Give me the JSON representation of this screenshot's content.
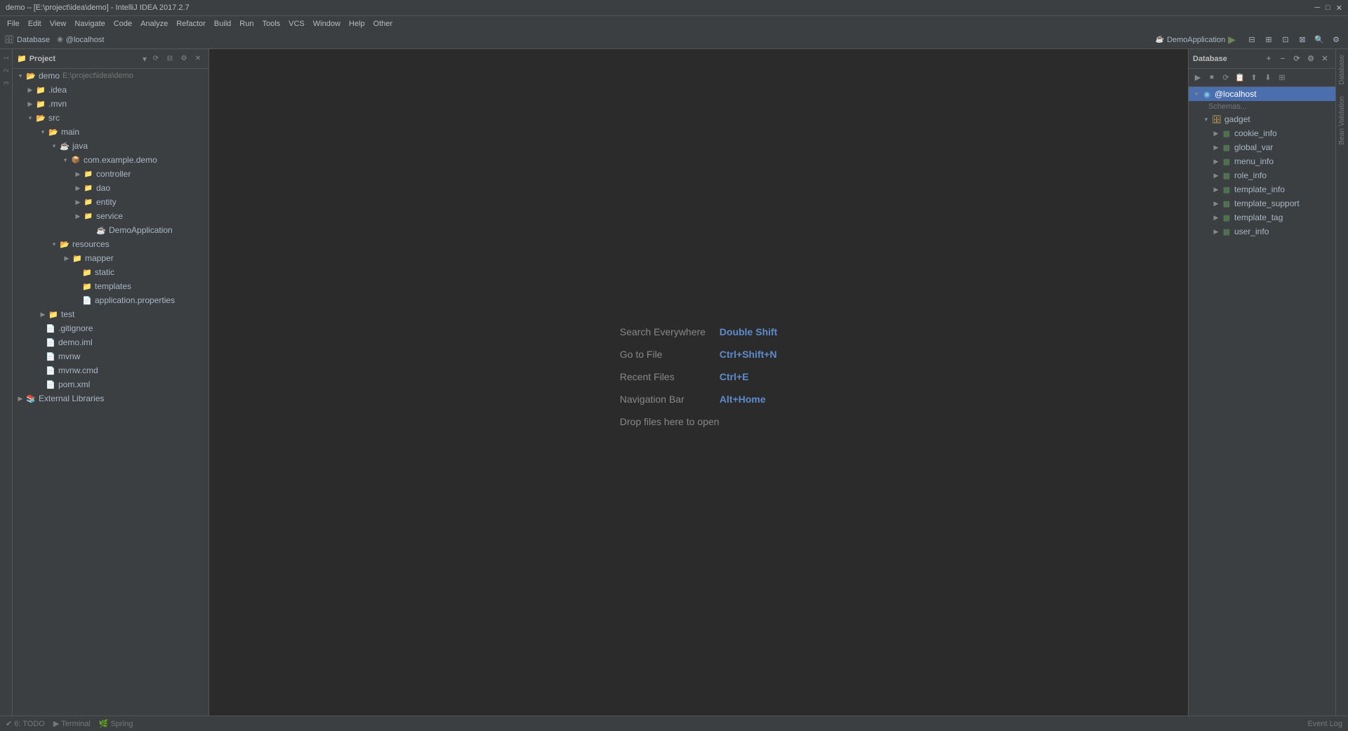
{
  "titleBar": {
    "text": "demo – [E:\\project\\idea\\demo] - IntelliJ IDEA 2017.2.7"
  },
  "menuBar": {
    "items": [
      "File",
      "Edit",
      "View",
      "Navigate",
      "Code",
      "Analyze",
      "Refactor",
      "Build",
      "Run",
      "Tools",
      "VCS",
      "Window",
      "Help",
      "Other"
    ]
  },
  "topBar": {
    "database": "Database",
    "host": "@localhost",
    "appName": "DemoApplication",
    "runBtn": "▶"
  },
  "projectPanel": {
    "title": "Project",
    "dropdown": "▾",
    "tree": [
      {
        "id": "demo",
        "label": "demo",
        "path": "E:\\project\\idea\\demo",
        "type": "root",
        "indent": 0,
        "expanded": true,
        "arrow": "▾"
      },
      {
        "id": "idea",
        "label": ".idea",
        "type": "folder",
        "indent": 1,
        "expanded": false,
        "arrow": "▶"
      },
      {
        "id": "mvn",
        "label": ".mvn",
        "type": "folder",
        "indent": 1,
        "expanded": false,
        "arrow": "▶"
      },
      {
        "id": "src",
        "label": "src",
        "type": "src",
        "indent": 1,
        "expanded": true,
        "arrow": "▾"
      },
      {
        "id": "main",
        "label": "main",
        "type": "folder",
        "indent": 2,
        "expanded": true,
        "arrow": "▾"
      },
      {
        "id": "java",
        "label": "java",
        "type": "java",
        "indent": 3,
        "expanded": true,
        "arrow": "▾"
      },
      {
        "id": "com",
        "label": "com.example.demo",
        "type": "package",
        "indent": 4,
        "expanded": true,
        "arrow": "▾"
      },
      {
        "id": "controller",
        "label": "controller",
        "type": "package",
        "indent": 5,
        "expanded": false,
        "arrow": "▶"
      },
      {
        "id": "dao",
        "label": "dao",
        "type": "package",
        "indent": 5,
        "expanded": false,
        "arrow": "▶"
      },
      {
        "id": "entity",
        "label": "entity",
        "type": "package",
        "indent": 5,
        "expanded": false,
        "arrow": "▶"
      },
      {
        "id": "service",
        "label": "service",
        "type": "package",
        "indent": 5,
        "expanded": false,
        "arrow": "▶"
      },
      {
        "id": "DemoApplication",
        "label": "DemoApplication",
        "type": "mainclass",
        "indent": 5,
        "arrow": ""
      },
      {
        "id": "resources",
        "label": "resources",
        "type": "resources",
        "indent": 3,
        "expanded": true,
        "arrow": "▾"
      },
      {
        "id": "mapper",
        "label": "mapper",
        "type": "folder",
        "indent": 4,
        "expanded": false,
        "arrow": "▶"
      },
      {
        "id": "static",
        "label": "static",
        "type": "folder",
        "indent": 4,
        "arrow": ""
      },
      {
        "id": "templates",
        "label": "templates",
        "type": "folder",
        "indent": 4,
        "arrow": ""
      },
      {
        "id": "appprops",
        "label": "application.properties",
        "type": "properties",
        "indent": 4,
        "arrow": ""
      },
      {
        "id": "test",
        "label": "test",
        "type": "folder",
        "indent": 2,
        "expanded": false,
        "arrow": "▶"
      },
      {
        "id": "gitignore",
        "label": ".gitignore",
        "type": "gitignore",
        "indent": 1,
        "arrow": ""
      },
      {
        "id": "demoiml",
        "label": "demo.iml",
        "type": "iml",
        "indent": 1,
        "arrow": ""
      },
      {
        "id": "mvnw",
        "label": "mvnw",
        "type": "file",
        "indent": 1,
        "arrow": ""
      },
      {
        "id": "mvnwcmd",
        "label": "mvnw.cmd",
        "type": "file",
        "indent": 1,
        "arrow": ""
      },
      {
        "id": "pomxml",
        "label": "pom.xml",
        "type": "xml",
        "indent": 1,
        "arrow": ""
      },
      {
        "id": "extlib",
        "label": "External Libraries",
        "type": "external",
        "indent": 0,
        "expanded": false,
        "arrow": "▶"
      }
    ]
  },
  "editor": {
    "searchLabel": "Search Everywhere",
    "searchShortcut": "Double Shift",
    "gotoLabel": "Go to File",
    "gotoShortcut": "Ctrl+Shift+N",
    "recentLabel": "Recent Files",
    "recentShortcut": "Ctrl+E",
    "navLabel": "Navigation Bar",
    "navShortcut": "Alt+Home",
    "dropText": "Drop files here to open"
  },
  "database": {
    "title": "Database",
    "host": "@localhost",
    "schemasLabel": "Schemas...",
    "tree": [
      {
        "id": "gadget",
        "label": "gadget",
        "type": "schema",
        "indent": 1,
        "expanded": true,
        "arrow": "▾"
      },
      {
        "id": "cookie_info",
        "label": "cookie_info",
        "type": "table",
        "indent": 2,
        "arrow": "▶"
      },
      {
        "id": "global_var",
        "label": "global_var",
        "type": "table",
        "indent": 2,
        "arrow": "▶"
      },
      {
        "id": "menu_info",
        "label": "menu_info",
        "type": "table",
        "indent": 2,
        "arrow": "▶"
      },
      {
        "id": "role_info",
        "label": "role_info",
        "type": "table",
        "indent": 2,
        "arrow": "▶"
      },
      {
        "id": "template_info",
        "label": "template_info",
        "type": "table",
        "indent": 2,
        "arrow": "▶"
      },
      {
        "id": "template_support",
        "label": "template_support",
        "type": "table",
        "indent": 2,
        "arrow": "▶"
      },
      {
        "id": "template_tag",
        "label": "template_tag",
        "type": "table",
        "indent": 2,
        "arrow": "▶"
      },
      {
        "id": "user_info",
        "label": "user_info",
        "type": "table",
        "indent": 2,
        "arrow": "▶"
      }
    ]
  },
  "statusBar": {
    "todo": "6: TODO",
    "terminal": "Terminal",
    "spring": "Spring",
    "eventLog": "Event Log"
  },
  "rightSideTabs": [
    "Database",
    "Bean Validation"
  ],
  "leftTabs": [
    "1",
    "2",
    "3"
  ]
}
